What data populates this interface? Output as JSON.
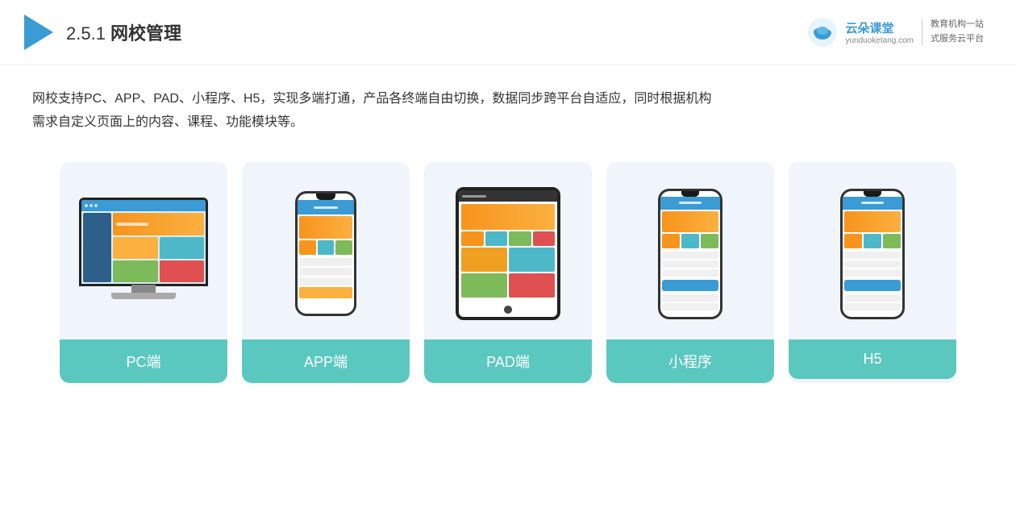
{
  "header": {
    "title_prefix": "2.5.1 ",
    "title_main": "网校管理",
    "brand_name": "云朵课堂",
    "brand_url": "yunduoketang.com",
    "brand_slogan_line1": "教育机构一站",
    "brand_slogan_line2": "式服务云平台"
  },
  "description": {
    "line1": "网校支持PC、APP、PAD、小程序、H5，实现多端打通，产品各终端自由切换，数据同步跨平台自适应，同时根据机构",
    "line2": "需求自定义页面上的内容、课程、功能模块等。"
  },
  "cards": [
    {
      "label": "PC端",
      "device_type": "pc"
    },
    {
      "label": "APP端",
      "device_type": "mobile"
    },
    {
      "label": "PAD端",
      "device_type": "pad"
    },
    {
      "label": "小程序",
      "device_type": "small_mobile"
    },
    {
      "label": "H5",
      "device_type": "small_mobile2"
    }
  ]
}
